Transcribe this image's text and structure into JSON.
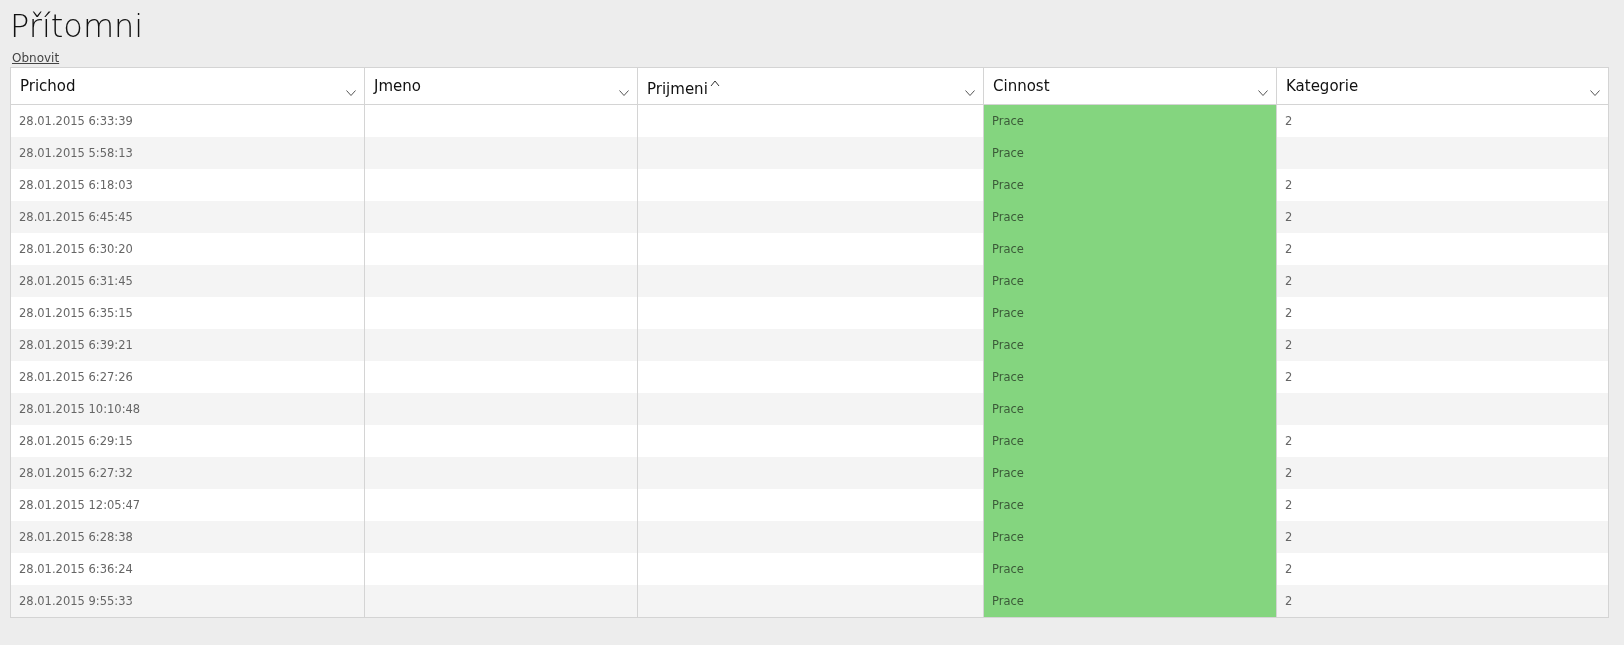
{
  "title": "Přítomni",
  "refresh_link": "Obnovit",
  "table": {
    "columns": [
      {
        "label": "Prichod",
        "sorted": false
      },
      {
        "label": "Jmeno",
        "sorted": false
      },
      {
        "label": "Prijmeni",
        "sorted": true
      },
      {
        "label": "Cinnost",
        "sorted": false,
        "color": "#84d57f"
      },
      {
        "label": "Kategorie",
        "sorted": false
      }
    ],
    "rows": [
      {
        "prichod": "28.01.2015 6:33:39",
        "cinnost": "Prace",
        "kategorie": "2"
      },
      {
        "prichod": "28.01.2015 5:58:13",
        "cinnost": "Prace"
      },
      {
        "prichod": "28.01.2015 6:18:03",
        "cinnost": "Prace",
        "kategorie": "2"
      },
      {
        "prichod": "28.01.2015 6:45:45",
        "cinnost": "Prace",
        "kategorie": "2"
      },
      {
        "prichod": "28.01.2015 6:30:20",
        "cinnost": "Prace",
        "kategorie": "2"
      },
      {
        "prichod": "28.01.2015 6:31:45",
        "cinnost": "Prace",
        "kategorie": "2"
      },
      {
        "prichod": "28.01.2015 6:35:15",
        "cinnost": "Prace",
        "kategorie": "2"
      },
      {
        "prichod": "28.01.2015 6:39:21",
        "cinnost": "Prace",
        "kategorie": "2"
      },
      {
        "prichod": "28.01.2015 6:27:26",
        "cinnost": "Prace",
        "kategorie": "2"
      },
      {
        "prichod": "28.01.2015 10:10:48",
        "cinnost": "Prace"
      },
      {
        "prichod": "28.01.2015 6:29:15",
        "cinnost": "Prace",
        "kategorie": "2"
      },
      {
        "prichod": "28.01.2015 6:27:32",
        "cinnost": "Prace",
        "kategorie": "2"
      },
      {
        "prichod": "28.01.2015 12:05:47",
        "cinnost": "Prace",
        "kategorie": "2"
      },
      {
        "prichod": "28.01.2015 6:28:38",
        "cinnost": "Prace",
        "kategorie": "2"
      },
      {
        "prichod": "28.01.2015 6:36:24",
        "cinnost": "Prace",
        "kategorie": "2"
      },
      {
        "prichod": "28.01.2015 9:55:33",
        "cinnost": "Prace",
        "kategorie": "2"
      }
    ]
  }
}
